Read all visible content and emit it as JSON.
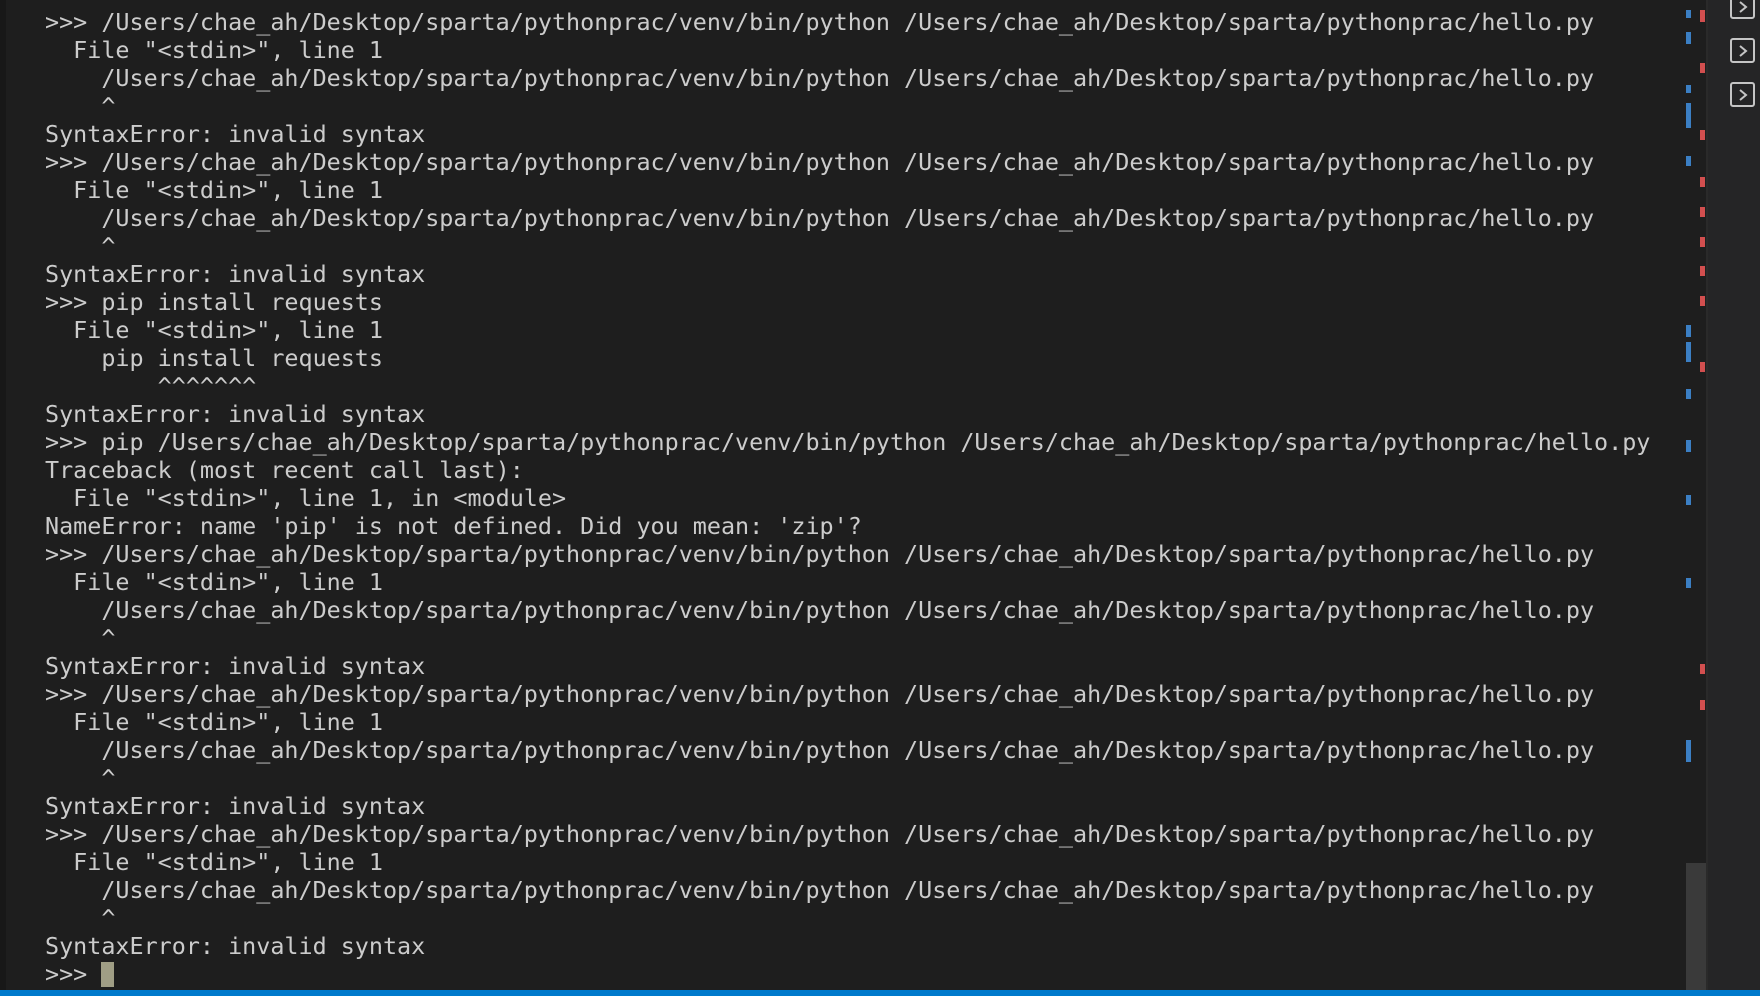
{
  "terminal": {
    "lines": [
      ">>> /Users/chae_ah/Desktop/sparta/pythonprac/venv/bin/python /Users/chae_ah/Desktop/sparta/pythonprac/hello.py",
      "  File \"<stdin>\", line 1",
      "    /Users/chae_ah/Desktop/sparta/pythonprac/venv/bin/python /Users/chae_ah/Desktop/sparta/pythonprac/hello.py",
      "    ^",
      "SyntaxError: invalid syntax",
      ">>> /Users/chae_ah/Desktop/sparta/pythonprac/venv/bin/python /Users/chae_ah/Desktop/sparta/pythonprac/hello.py",
      "  File \"<stdin>\", line 1",
      "    /Users/chae_ah/Desktop/sparta/pythonprac/venv/bin/python /Users/chae_ah/Desktop/sparta/pythonprac/hello.py",
      "    ^",
      "SyntaxError: invalid syntax",
      ">>> pip install requests",
      "  File \"<stdin>\", line 1",
      "    pip install requests",
      "        ^^^^^^^",
      "SyntaxError: invalid syntax",
      ">>> pip /Users/chae_ah/Desktop/sparta/pythonprac/venv/bin/python /Users/chae_ah/Desktop/sparta/pythonprac/hello.py",
      "Traceback (most recent call last):",
      "  File \"<stdin>\", line 1, in <module>",
      "NameError: name 'pip' is not defined. Did you mean: 'zip'?",
      ">>> /Users/chae_ah/Desktop/sparta/pythonprac/venv/bin/python /Users/chae_ah/Desktop/sparta/pythonprac/hello.py",
      "  File \"<stdin>\", line 1",
      "    /Users/chae_ah/Desktop/sparta/pythonprac/venv/bin/python /Users/chae_ah/Desktop/sparta/pythonprac/hello.py",
      "    ^",
      "SyntaxError: invalid syntax",
      ">>> /Users/chae_ah/Desktop/sparta/pythonprac/venv/bin/python /Users/chae_ah/Desktop/sparta/pythonprac/hello.py",
      "  File \"<stdin>\", line 1",
      "    /Users/chae_ah/Desktop/sparta/pythonprac/venv/bin/python /Users/chae_ah/Desktop/sparta/pythonprac/hello.py",
      "    ^",
      "SyntaxError: invalid syntax",
      ">>> /Users/chae_ah/Desktop/sparta/pythonprac/venv/bin/python /Users/chae_ah/Desktop/sparta/pythonprac/hello.py",
      "  File \"<stdin>\", line 1",
      "    /Users/chae_ah/Desktop/sparta/pythonprac/venv/bin/python /Users/chae_ah/Desktop/sparta/pythonprac/hello.py",
      "    ^",
      "SyntaxError: invalid syntax"
    ],
    "prompt": ">>> "
  },
  "right_panel": {
    "tabs": [
      {
        "icon": "terminal-icon"
      },
      {
        "icon": "terminal-icon"
      },
      {
        "icon": "terminal-icon"
      }
    ]
  },
  "colors": {
    "background": "#1e1e1e",
    "text": "#cccccc",
    "cursor": "#a09e85",
    "ruler_blue": "#3b7fc4",
    "ruler_red": "#d24f4f",
    "status_bar": "#007acc"
  }
}
